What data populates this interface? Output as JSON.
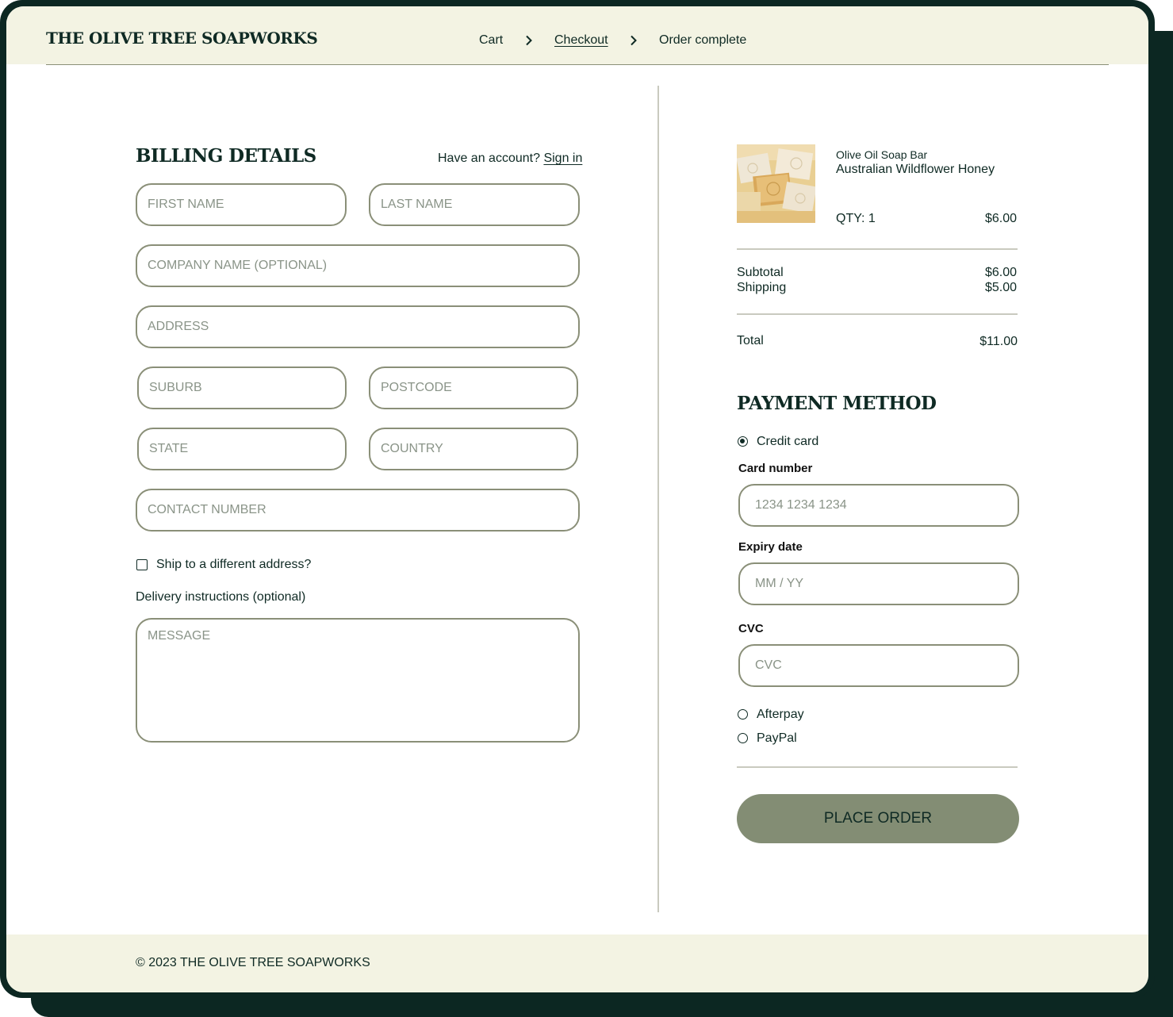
{
  "brand": "THE OLIVE TREE SOAPWORKS",
  "breadcrumbs": [
    {
      "label": "Cart"
    },
    {
      "label": "Checkout",
      "current": true
    },
    {
      "label": "Order complete"
    }
  ],
  "billing": {
    "heading": "BILLING DETAILS",
    "account_prompt": "Have an account?",
    "sign_in": "Sign in",
    "fields": {
      "first_name": "FIRST NAME",
      "last_name": "LAST NAME",
      "company": "COMPANY NAME (OPTIONAL)",
      "address": "ADDRESS",
      "suburb": "SUBURB",
      "postcode": "POSTCODE",
      "state": "STATE",
      "country": "COUNTRY",
      "contact": "CONTACT NUMBER"
    },
    "ship_different": "Ship to a different address?",
    "ship_different_checked": false,
    "delivery_label": "Delivery instructions (optional)",
    "message_placeholder": "MESSAGE"
  },
  "order": {
    "item": {
      "category": "Olive Oil Soap Bar",
      "name": "Australian Wildflower Honey",
      "qty": "QTY: 1",
      "price": "$6.00",
      "image": "soap-bars-image"
    },
    "subtotal_label": "Subtotal",
    "subtotal": "$6.00",
    "shipping_label": "Shipping",
    "shipping": "$5.00",
    "total_label": "Total",
    "total": "$11.00"
  },
  "payment": {
    "heading": "PAYMENT METHOD",
    "methods": [
      {
        "label": "Credit card",
        "selected": true
      },
      {
        "label": "Afterpay",
        "selected": false
      },
      {
        "label": "PayPal",
        "selected": false
      }
    ],
    "card_number_label": "Card number",
    "card_number_placeholder": "1234 1234 1234",
    "expiry_label": "Expiry date",
    "expiry_placeholder": "MM / YY",
    "cvc_label": "CVC",
    "cvc_placeholder": "CVC",
    "place_order": "PLACE ORDER"
  },
  "footer": "© 2023 THE OLIVE TREE SOAPWORKS",
  "colors": {
    "dark_green": "#0c2722",
    "cream": "#f3f3e3",
    "olive_border": "#8a8f78",
    "button_olive": "#838d74"
  }
}
